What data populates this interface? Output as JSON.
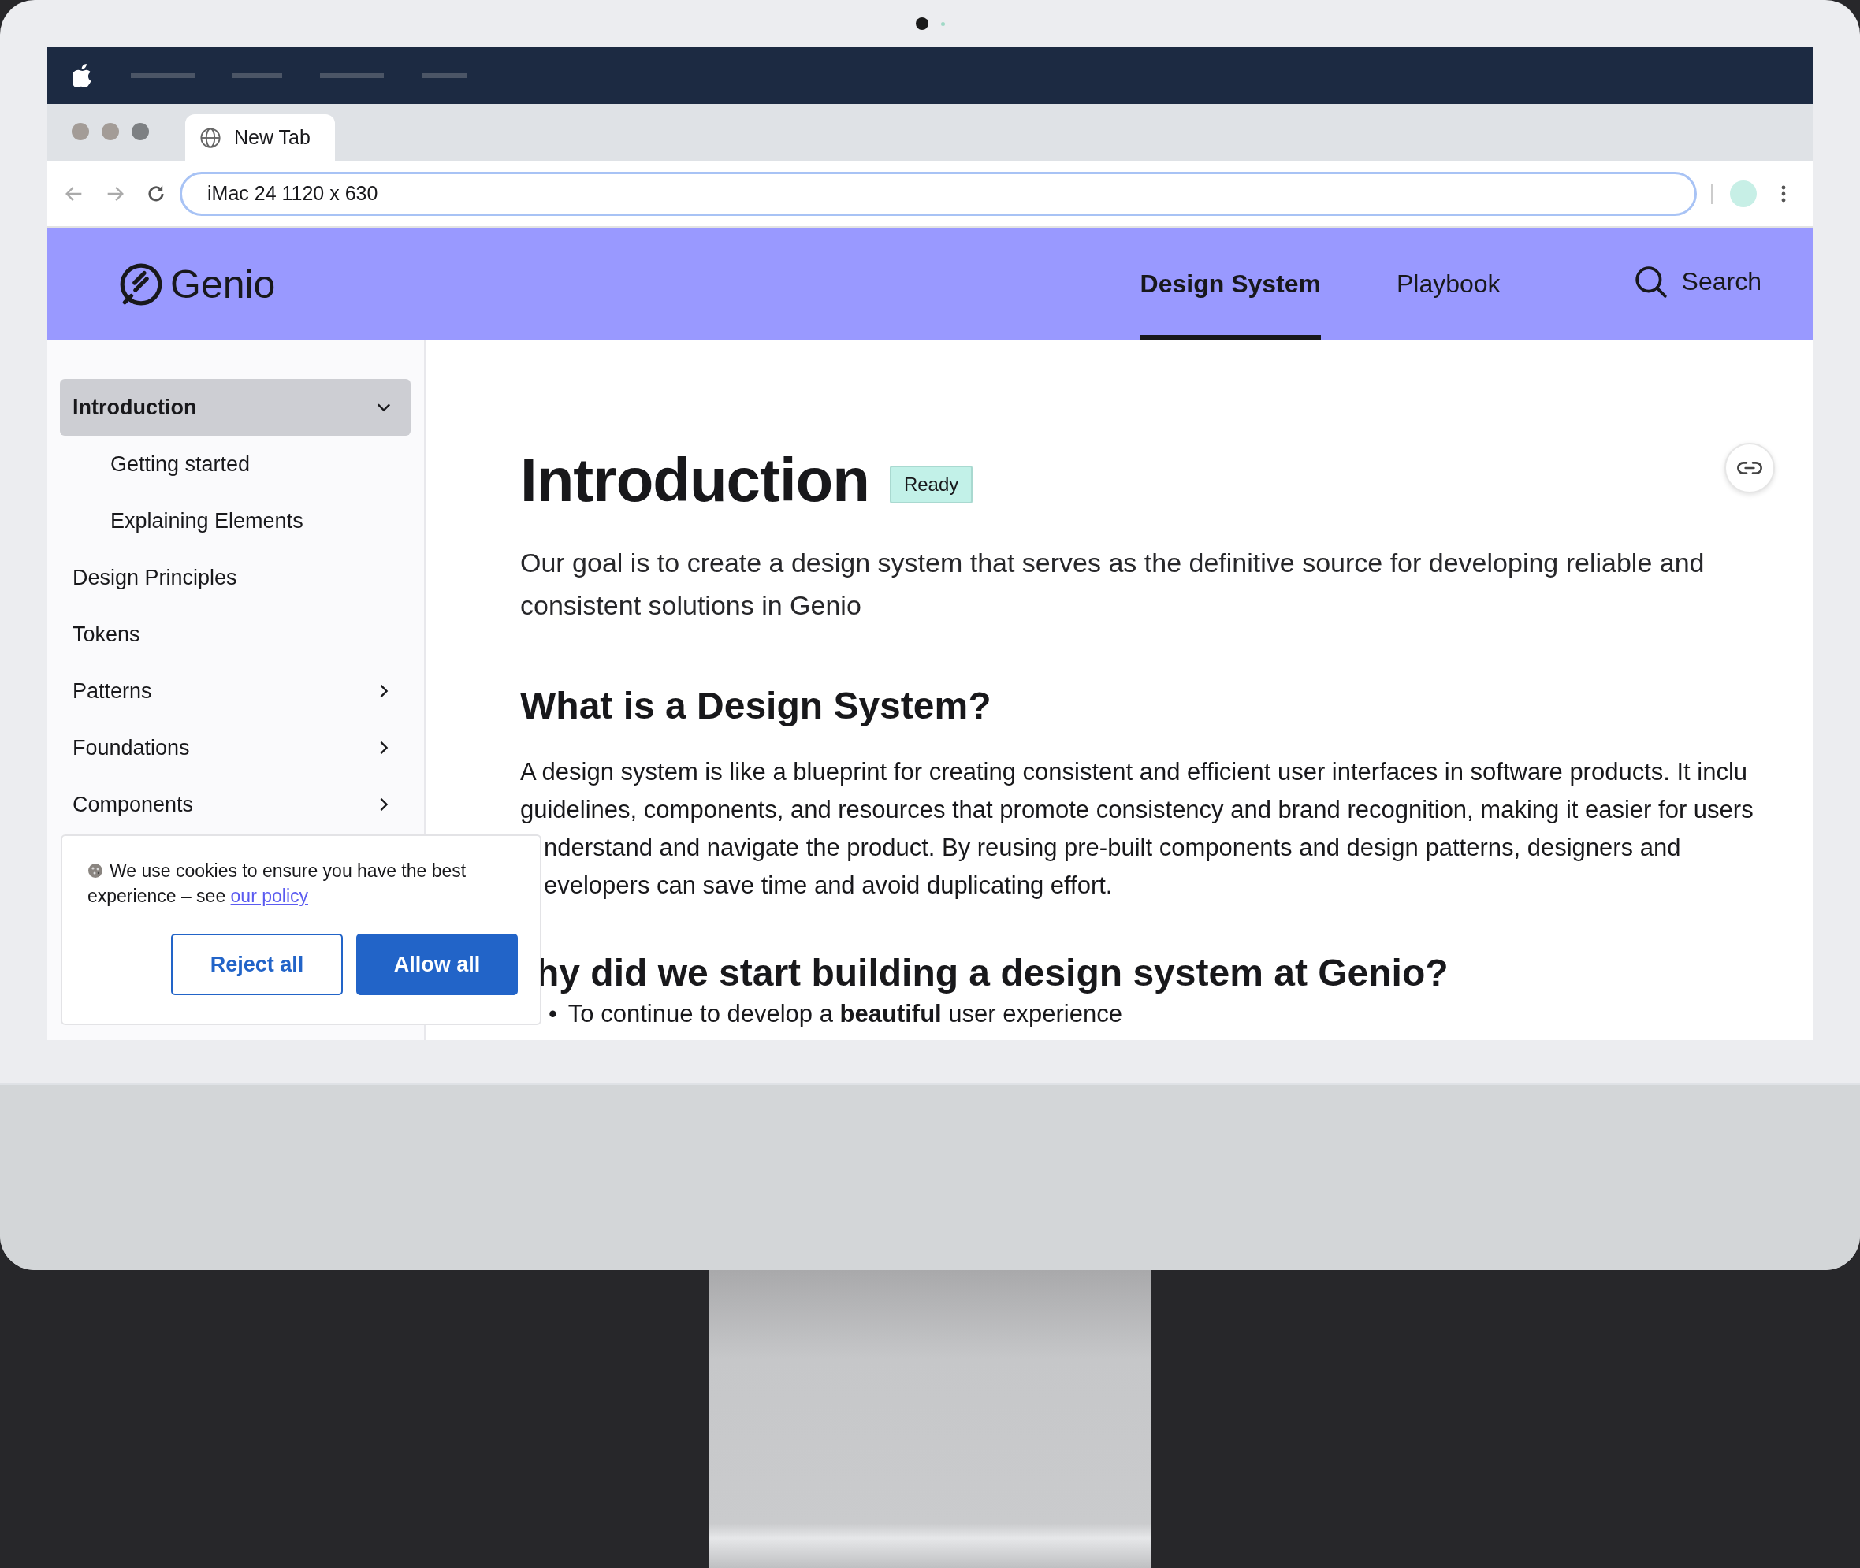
{
  "browser": {
    "tab": {
      "title": "New Tab"
    },
    "address": {
      "value": "iMac 24  1120 x 630"
    }
  },
  "site": {
    "logo": "Genio",
    "nav": [
      {
        "label": "Design System",
        "selected": true
      },
      {
        "label": "Playbook",
        "selected": false
      }
    ],
    "search": {
      "label": "Search"
    }
  },
  "sidebar": {
    "items": [
      {
        "label": "Introduction",
        "kind": "group",
        "selected": true,
        "expanded": true,
        "children": [
          {
            "label": "Getting started",
            "selected": false
          },
          {
            "label": "Explaining Elements",
            "selected": false
          }
        ]
      },
      {
        "label": "Design Principles",
        "kind": "link",
        "selected": false
      },
      {
        "label": "Tokens",
        "kind": "link",
        "selected": false
      },
      {
        "label": "Patterns",
        "kind": "group",
        "selected": false,
        "expanded": false
      },
      {
        "label": "Foundations",
        "kind": "group",
        "selected": false,
        "expanded": false
      },
      {
        "label": "Components",
        "kind": "group",
        "selected": false,
        "expanded": false
      }
    ]
  },
  "page": {
    "title": "Introduction",
    "status": "Ready",
    "lead": "Our goal is to create a design system that serves as the definitive source for developing reliable and consistent solutions in Genio",
    "sections": [
      {
        "heading": {
          "text": "What is a Design System?",
          "clipped": false
        },
        "lines": [
          {
            "text": "A design system is like a blueprint for creating consistent and efficient user interfaces in software products. It inclu",
            "clipped": false
          },
          {
            "text": "guidelines, components, and resources that promote consistency and brand recognition, making it easier for users",
            "clipped": false
          },
          {
            "text": "nderstand and navigate the product. By reusing pre-built components and design patterns, designers and",
            "clipped": true
          },
          {
            "text": "evelopers can save time and avoid duplicating effort.",
            "clipped": true
          }
        ]
      },
      {
        "heading": {
          "text": "hy did we start building a design system at Genio?",
          "clipped": true
        },
        "bullets": [
          {
            "marker": "•",
            "text": "To continue to develop a **beautiful** user experience"
          }
        ]
      }
    ]
  },
  "cookie_banner": {
    "message": "We use cookies to ensure you have the best experience – see ",
    "link": "our policy",
    "buttons": [
      {
        "label": "Reject all",
        "kind": "secondary"
      },
      {
        "label": "Allow all",
        "kind": "primary"
      }
    ]
  }
}
